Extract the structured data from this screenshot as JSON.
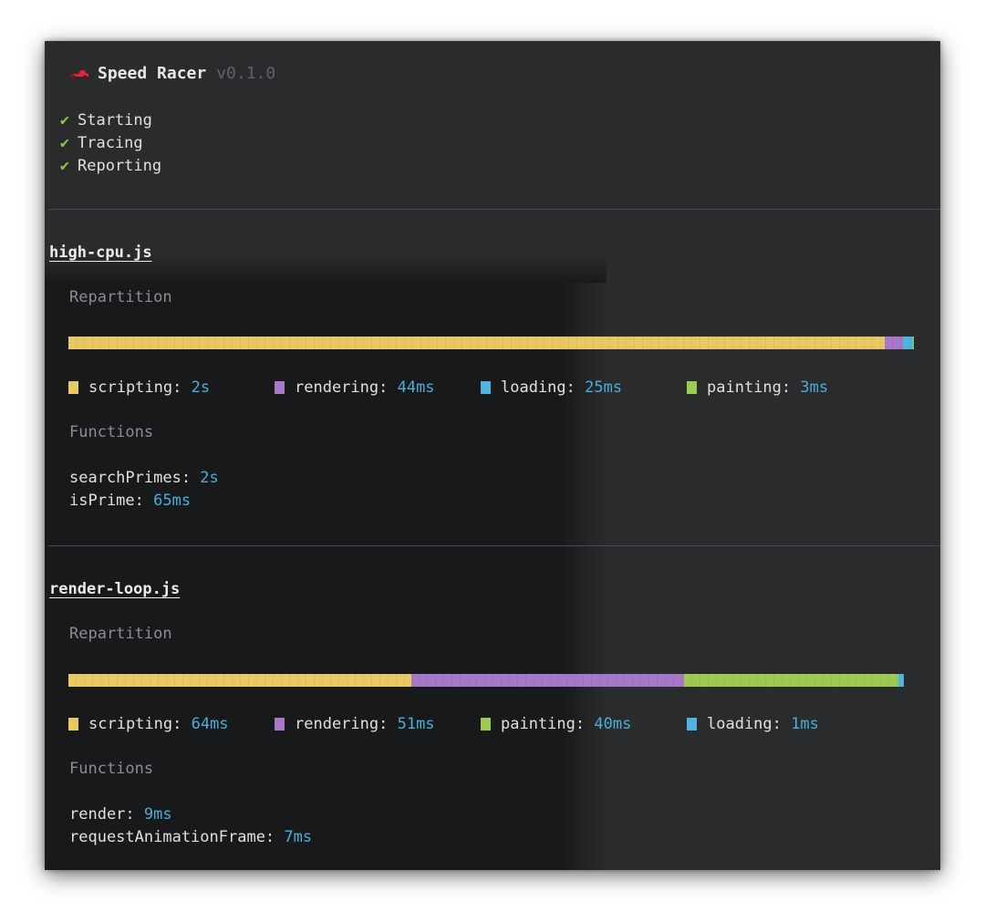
{
  "app": {
    "name": "Speed Racer",
    "version": "v0.1.0",
    "icon": "race-car-icon"
  },
  "steps": [
    {
      "icon": "check-icon",
      "label": "Starting"
    },
    {
      "icon": "check-icon",
      "label": "Tracing"
    },
    {
      "icon": "check-icon",
      "label": "Reporting"
    }
  ],
  "colors": {
    "scripting": "#e8c962",
    "rendering": "#a878c8",
    "loading": "#4fb4e0",
    "painting": "#9ccb52",
    "value": "#4aaed8",
    "check": "#8cc34a"
  },
  "reports": [
    {
      "file": "high-cpu.js",
      "repartition_label": "Repartition",
      "functions_label": "Functions",
      "repartition": [
        {
          "name": "scripting",
          "label": "scripting: ",
          "value": "2s",
          "ms": 2000
        },
        {
          "name": "rendering",
          "label": "rendering: ",
          "value": "44ms",
          "ms": 44
        },
        {
          "name": "loading",
          "label": "loading: ",
          "value": "25ms",
          "ms": 25
        },
        {
          "name": "painting",
          "label": "painting: ",
          "value": "3ms",
          "ms": 3
        }
      ],
      "functions": [
        {
          "name": "searchPrimes: ",
          "value": "2s"
        },
        {
          "name": "isPrime: ",
          "value": "65ms"
        }
      ]
    },
    {
      "file": "render-loop.js",
      "repartition_label": "Repartition",
      "functions_label": "Functions",
      "repartition": [
        {
          "name": "scripting",
          "label": "scripting: ",
          "value": "64ms",
          "ms": 64
        },
        {
          "name": "rendering",
          "label": "rendering: ",
          "value": "51ms",
          "ms": 51
        },
        {
          "name": "painting",
          "label": "painting: ",
          "value": "40ms",
          "ms": 40
        },
        {
          "name": "loading",
          "label": "loading: ",
          "value": "1ms",
          "ms": 1
        }
      ],
      "functions": [
        {
          "name": "render: ",
          "value": "9ms"
        },
        {
          "name": "requestAnimationFrame: ",
          "value": "7ms"
        }
      ]
    }
  ]
}
